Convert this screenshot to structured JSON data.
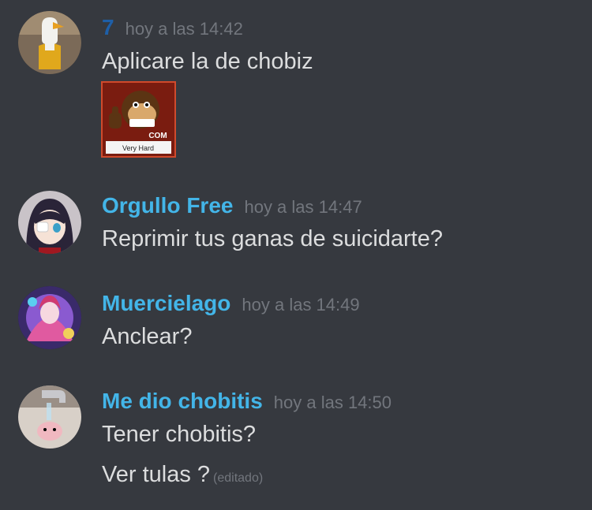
{
  "messages": [
    {
      "author": "7",
      "time": "hoy a las 14:42",
      "lines": [
        "Aplicare la de chobiz"
      ],
      "attachment": {
        "caption": "Very Hard",
        "logo_text": "COM"
      }
    },
    {
      "author": "Orgullo Free",
      "time": "hoy a las 14:47",
      "lines": [
        "Reprimir tus ganas de suicidarte?"
      ]
    },
    {
      "author": "Muercielago",
      "time": "hoy a las 14:49",
      "lines": [
        "Anclear?"
      ]
    },
    {
      "author": "Me dio chobitis",
      "time": "hoy a las 14:50",
      "lines": [
        "Tener chobitis?",
        "Ver tulas ?"
      ],
      "edited": "(editado)"
    }
  ],
  "colors": {
    "background": "#36393f",
    "author": "#43b5e8",
    "author_7": "#1e5fa8",
    "timestamp": "#72767d",
    "text": "#dcddde"
  }
}
